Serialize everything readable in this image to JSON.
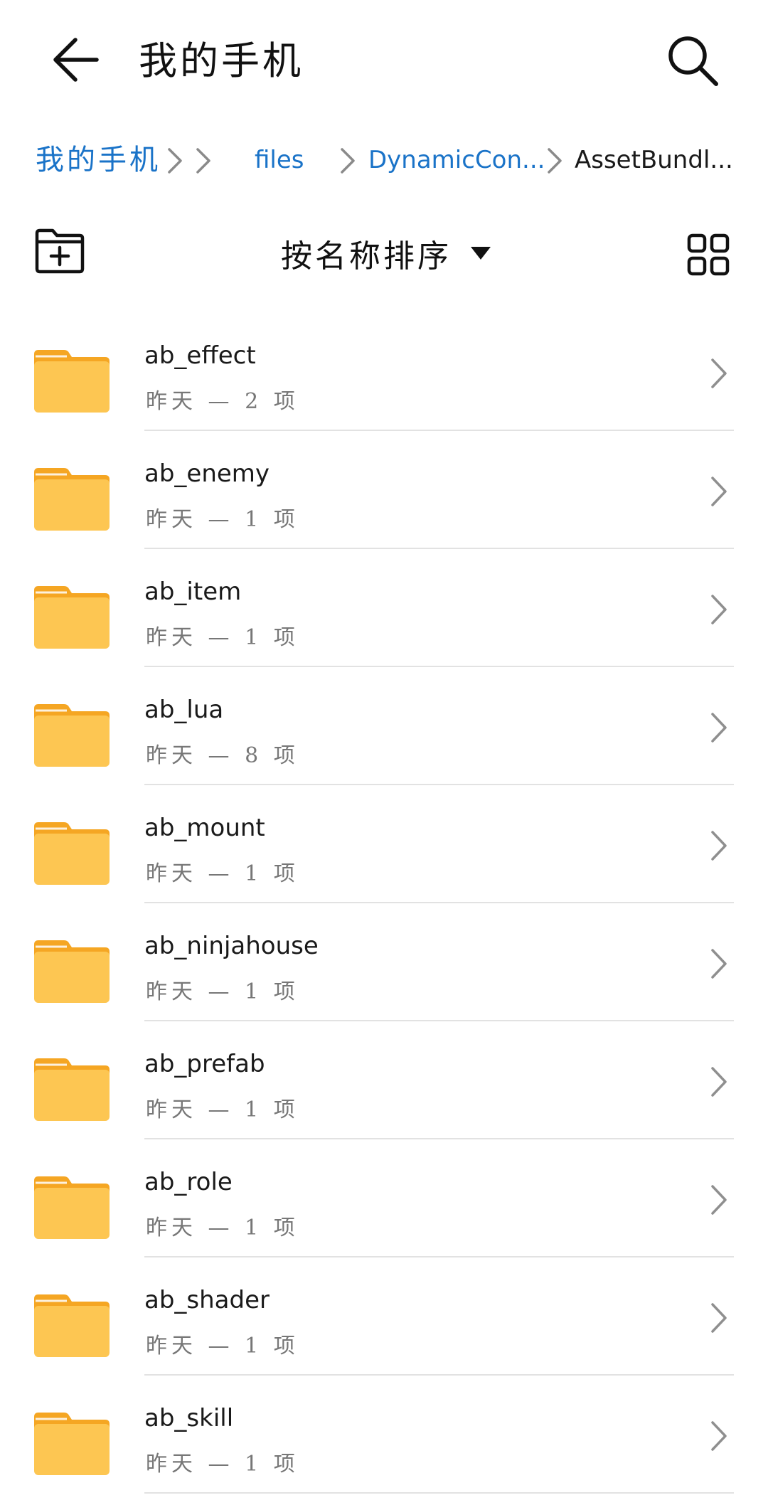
{
  "appbar": {
    "title": "我的手机"
  },
  "breadcrumbs": [
    {
      "label": "我的手机",
      "state": "link"
    },
    {
      "label": "files",
      "state": "link"
    },
    {
      "label": "DynamicCon...",
      "state": "link"
    },
    {
      "label": "AssetBundl...",
      "state": "current"
    }
  ],
  "toolbar": {
    "sort_label": "按名称排序"
  },
  "folders": [
    {
      "name": "ab_effect",
      "meta": "昨天 — 2 项"
    },
    {
      "name": "ab_enemy",
      "meta": "昨天 — 1 项"
    },
    {
      "name": "ab_item",
      "meta": "昨天 — 1 项"
    },
    {
      "name": "ab_lua",
      "meta": "昨天 — 8 项"
    },
    {
      "name": "ab_mount",
      "meta": "昨天 — 1 项"
    },
    {
      "name": "ab_ninjahouse",
      "meta": "昨天 — 1 项"
    },
    {
      "name": "ab_prefab",
      "meta": "昨天 — 1 项"
    },
    {
      "name": "ab_role",
      "meta": "昨天 — 1 项"
    },
    {
      "name": "ab_shader",
      "meta": "昨天 — 1 项"
    },
    {
      "name": "ab_skill",
      "meta": "昨天 — 1 项"
    }
  ],
  "icons": {
    "back": "arrow-left-icon",
    "search": "search-icon",
    "new_folder": "new-folder-icon",
    "sort_caret": "caret-down-icon",
    "view_toggle": "grid-view-icon",
    "folder": "folder-icon",
    "row_chevron": "chevron-right-icon"
  },
  "colors": {
    "link": "#1a73c8",
    "folder_body": "#fdc652",
    "folder_tab": "#f5a623",
    "divider": "#e2e2e2",
    "meta_text": "#777777"
  }
}
